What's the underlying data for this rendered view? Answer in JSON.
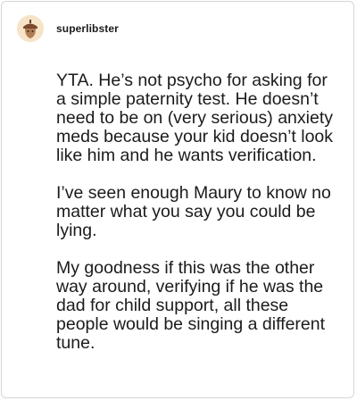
{
  "comment": {
    "username": "superlibster",
    "avatar_icon": "acorn-avatar-icon",
    "paragraphs": [
      "YTA. He’s not psycho for asking for a simple paternity test. He doesn’t need to be on (very serious) anxiety meds because your kid doesn’t look like him and he wants verification.",
      "I’ve seen enough Maury to know no matter what you say you could be lying.",
      "My goodness if this was the other way around, verifying if he was the dad for child support, all these people would be singing a different tune."
    ]
  },
  "colors": {
    "avatar_bg": "#f6e3c8",
    "avatar_fg": "#8a5a3a",
    "text": "#1b1b1b",
    "border": "#d6d6d6"
  }
}
